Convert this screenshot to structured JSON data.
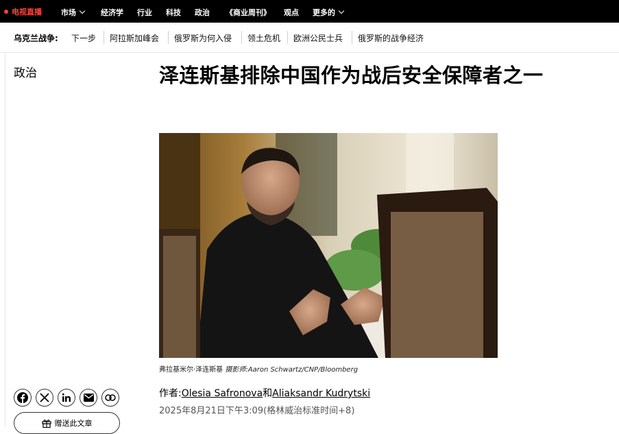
{
  "topnav": {
    "live": "电视直播",
    "items": [
      "市场",
      "经济学",
      "行业",
      "科技",
      "政治",
      "《商业周刊》",
      "观点",
      "更多的"
    ]
  },
  "subnav": {
    "title": "乌克兰战争:",
    "items": [
      "下一步",
      "阿拉斯加峰会",
      "俄罗斯为何入侵",
      "领土危机",
      "欧洲公民士兵",
      "俄罗斯的战争经济"
    ]
  },
  "section": "政治",
  "headline": "泽连斯基排除中国作为战后安全保障者之一",
  "photo": {
    "caption_subject": "弗拉基米尔·泽连斯基",
    "caption_credit": "摄影师:Aaron Schwartz/CNP/Bloomberg"
  },
  "byline": {
    "prefix": "作者:",
    "author1": "Olesia Safronova",
    "joiner": "和",
    "author2": "Aliaksandr Kudrytski",
    "date": "2025年8月21日下午3:09(格林威治标准时间+8)"
  },
  "share": {
    "icons": [
      "facebook-icon",
      "x-icon",
      "linkedin-icon",
      "email-icon",
      "link-icon"
    ],
    "gift_label": "赠送此文章"
  },
  "colors": {
    "live": "#ff433d",
    "nav_bg": "#000000"
  }
}
